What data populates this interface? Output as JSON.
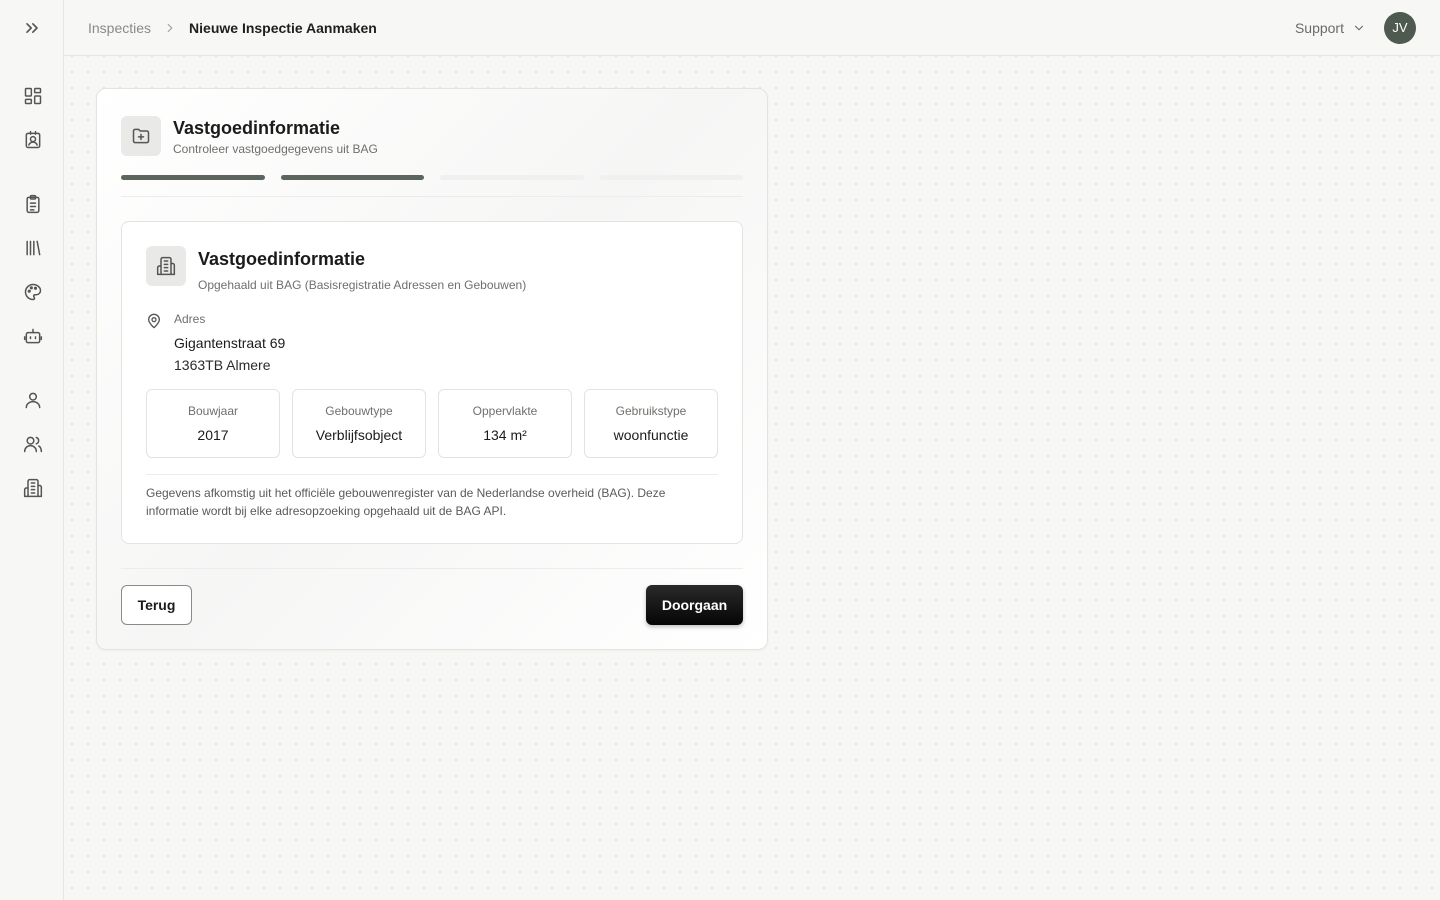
{
  "sidebar": {
    "toggle_icon": "chevrons-right-icon",
    "items": [
      {
        "name": "dashboard",
        "icon": "layout-grid-icon"
      },
      {
        "name": "contacts",
        "icon": "contact-card-icon"
      },
      {
        "name": "inspections",
        "icon": "clipboard-list-icon"
      },
      {
        "name": "library",
        "icon": "library-icon"
      },
      {
        "name": "theme",
        "icon": "palette-icon"
      },
      {
        "name": "automation",
        "icon": "robot-icon"
      },
      {
        "name": "profile",
        "icon": "user-icon"
      },
      {
        "name": "team",
        "icon": "users-icon"
      },
      {
        "name": "buildings",
        "icon": "building-icon"
      }
    ]
  },
  "header": {
    "breadcrumb_parent": "Inspecties",
    "breadcrumb_current": "Nieuwe Inspectie Aanmaken",
    "support_label": "Support",
    "avatar_initials": "JV"
  },
  "step": {
    "title": "Vastgoedinformatie",
    "subtitle": "Controleer vastgoedgegevens uit BAG",
    "progress": {
      "total_steps": 4,
      "completed_steps": 2
    }
  },
  "property": {
    "title": "Vastgoedinformatie",
    "subtitle": "Opgehaald uit BAG (Basisregistratie Adressen en Gebouwen)",
    "address_label": "Adres",
    "address_line1": "Gigantenstraat 69",
    "address_line2": "1363TB Almere",
    "stats": [
      {
        "label": "Bouwjaar",
        "value": "2017"
      },
      {
        "label": "Gebouwtype",
        "value": "Verblijfsobject"
      },
      {
        "label": "Oppervlakte",
        "value": "134 m²"
      },
      {
        "label": "Gebruikstype",
        "value": "woonfunctie"
      }
    ],
    "note": "Gegevens afkomstig uit het officiële gebouwenregister van de Nederlandse overheid (BAG). Deze informatie wordt bij elke adresopzoeking opgehaald uit de BAG API."
  },
  "actions": {
    "back_label": "Terug",
    "next_label": "Doorgaan"
  },
  "colors": {
    "progress_done": "#5d655f",
    "progress_todo": "#f0f0ef",
    "avatar_bg": "#4e5a50",
    "primary_button": "#111111"
  }
}
